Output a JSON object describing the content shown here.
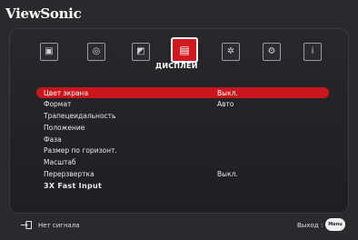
{
  "brand": "ViewSonic",
  "tabs": [
    {
      "icon": "image-icon",
      "glyph": "▣"
    },
    {
      "icon": "color-icon",
      "glyph": "◎"
    },
    {
      "icon": "picture-settings-icon",
      "glyph": "◩"
    },
    {
      "icon": "display-icon",
      "glyph": "▤",
      "active": true
    },
    {
      "icon": "settings-icon",
      "glyph": "✲"
    },
    {
      "icon": "options-icon",
      "glyph": "⚙"
    },
    {
      "icon": "info-icon",
      "glyph": "i"
    }
  ],
  "active_tab_label": "ДИСПЛЕЙ",
  "menu": [
    {
      "label": "Цвет экрана",
      "value": "Выкл."
    },
    {
      "label": "Формат",
      "value": "Авто"
    },
    {
      "label": "Трапецеидальность",
      "value": ""
    },
    {
      "label": "Положение",
      "value": ""
    },
    {
      "label": "Фаза",
      "value": ""
    },
    {
      "label": "Размер по горизонт.",
      "value": ""
    },
    {
      "label": "Масштаб",
      "value": ""
    },
    {
      "label": "Перерзвертка",
      "value": "Выкл."
    },
    {
      "label": "3X Fast Input",
      "value": ""
    }
  ],
  "footer": {
    "source_icon": "input-source-icon",
    "status": "Нет сигнала",
    "exit_label": "Выход :",
    "menu_button": "Menu"
  },
  "colors": {
    "accent": "#c8161c",
    "background": "#2a2a2d"
  }
}
